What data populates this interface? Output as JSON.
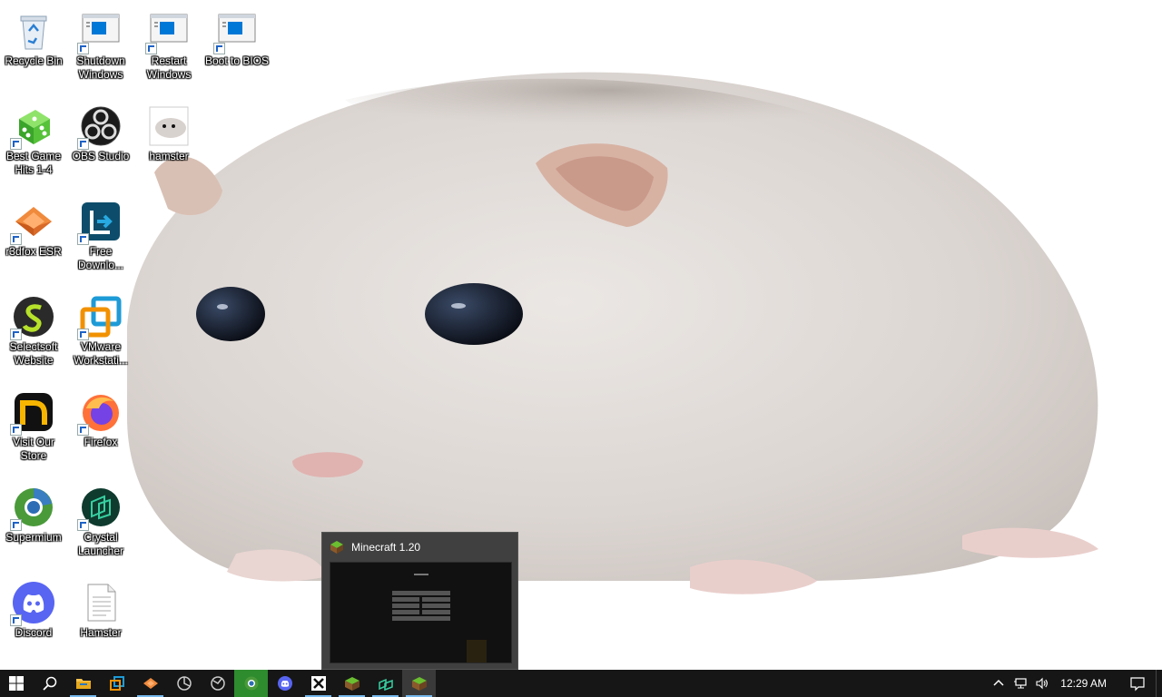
{
  "desktop": {
    "icons": [
      {
        "label": "Recycle Bin",
        "icon": "recycle-bin-icon"
      },
      {
        "label": "Shutdown Windows",
        "icon": "shortcut-window-icon"
      },
      {
        "label": "Restart Windows",
        "icon": "shortcut-window-icon"
      },
      {
        "label": "Boot to BIOS",
        "icon": "shortcut-window-icon"
      },
      {
        "label": "Best Game Hits 1-4",
        "icon": "green-dice-icon"
      },
      {
        "label": "OBS Studio",
        "icon": "obs-icon"
      },
      {
        "label": "hamster",
        "icon": "hamster-image-icon"
      },
      {
        "label": "r3dfox ESR",
        "icon": "r3dfox-icon"
      },
      {
        "label": "Free Downlo...",
        "icon": "free-download-manager-icon"
      },
      {
        "label": "Selectsoft Website",
        "icon": "selectsoft-icon"
      },
      {
        "label": "VMware Workstati...",
        "icon": "vmware-icon"
      },
      {
        "label": "Visit Our Store",
        "icon": "store-icon"
      },
      {
        "label": "Firefox",
        "icon": "firefox-icon"
      },
      {
        "label": "Supermium",
        "icon": "supermium-icon"
      },
      {
        "label": "Crystal Launcher",
        "icon": "crystal-launcher-icon"
      },
      {
        "label": "Discord",
        "icon": "discord-icon"
      },
      {
        "label": "Hamster",
        "icon": "text-file-icon"
      }
    ]
  },
  "preview": {
    "title": "Minecraft 1.20",
    "icon": "minecraft-grass-block-icon"
  },
  "taskbar": {
    "items": [
      {
        "name": "start-button",
        "icon": "windows-logo-icon"
      },
      {
        "name": "search-button",
        "icon": "search-icon"
      },
      {
        "name": "file-explorer",
        "icon": "folder-icon"
      },
      {
        "name": "vmware",
        "icon": "vmware-icon"
      },
      {
        "name": "r3dfox",
        "icon": "r3dfox-icon"
      },
      {
        "name": "app-circle-1",
        "icon": "circle-app-icon"
      },
      {
        "name": "app-circle-2",
        "icon": "circle-app-icon"
      },
      {
        "name": "supermium",
        "icon": "supermium-icon"
      },
      {
        "name": "discord",
        "icon": "discord-icon"
      },
      {
        "name": "app-x",
        "icon": "x-app-icon"
      },
      {
        "name": "minecraft-1",
        "icon": "minecraft-grass-block-icon"
      },
      {
        "name": "crystal-launcher",
        "icon": "crystal-launcher-icon"
      },
      {
        "name": "minecraft-2",
        "icon": "minecraft-grass-block-icon"
      }
    ],
    "tray": {
      "chevron": "chevron-up-icon",
      "network": "network-icon",
      "volume": "volume-icon",
      "time": "12:29 AM",
      "notifications": "notification-icon"
    }
  },
  "colors": {
    "taskbar": "#161616",
    "accent": "#76b9ed",
    "preview_bg": "#404040"
  }
}
